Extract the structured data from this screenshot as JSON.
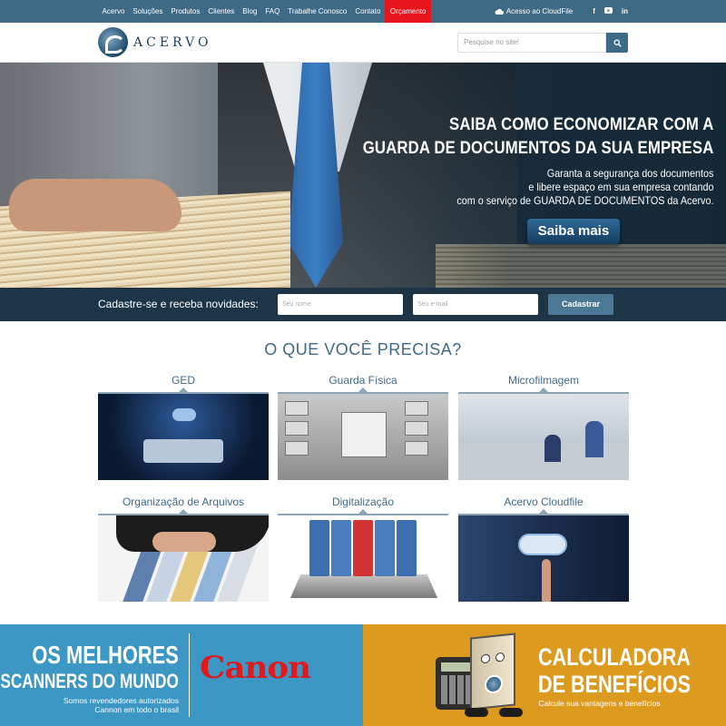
{
  "topnav": {
    "items": [
      "Acervo",
      "Soluções",
      "Produtos",
      "Clientes",
      "Blog",
      "FAQ",
      "Trabalhe Conosco",
      "Contato",
      "Orçamento"
    ],
    "cloudfile_label": "Acesso ao CloudFile",
    "highlight_color": "#e8141b"
  },
  "header": {
    "logo_text": "ACERVO",
    "search_placeholder": "Pesquise no site!"
  },
  "hero": {
    "title_line1": "SAIBA COMO ECONOMIZAR COM A",
    "title_line2": "GUARDA DE DOCUMENTOS DA SUA EMPRESA",
    "text_line1": "Garanta a segurança dos documentos",
    "text_line2": "e libere espaço em sua empresa contando",
    "text_line3": "com o serviço de GUARDA DE DOCUMENTOS da Acervo.",
    "button": "Saiba mais"
  },
  "newsletter": {
    "label": "Cadastre-se e receba novidades:",
    "name_placeholder": "Seu nome",
    "email_placeholder": "Seu e-mail",
    "button": "Cadastrar"
  },
  "services": {
    "title": "O QUE VOCÊ PRECISA?",
    "items": [
      {
        "label": "GED"
      },
      {
        "label": "Guarda Física"
      },
      {
        "label": "Microfilmagem"
      },
      {
        "label": "Organização de Arquivos"
      },
      {
        "label": "Digitalização"
      },
      {
        "label": "Acervo Cloudfile"
      }
    ]
  },
  "banner_canon": {
    "title_line1": "OS MELHORES",
    "title_line2": "SCANNERS DO MUNDO",
    "sub_line1": "Somos revendedores autorizados",
    "sub_line2": "Cannon em todo o brasil",
    "brand": "Canon",
    "bg_color": "#3c97c5"
  },
  "banner_calc": {
    "title_line1": "CALCULADORA",
    "title_line2": "DE BENEFÍCIOS",
    "sub": "Calcule sua vantagens e benefícios",
    "bg_color": "#dc9a1f"
  }
}
